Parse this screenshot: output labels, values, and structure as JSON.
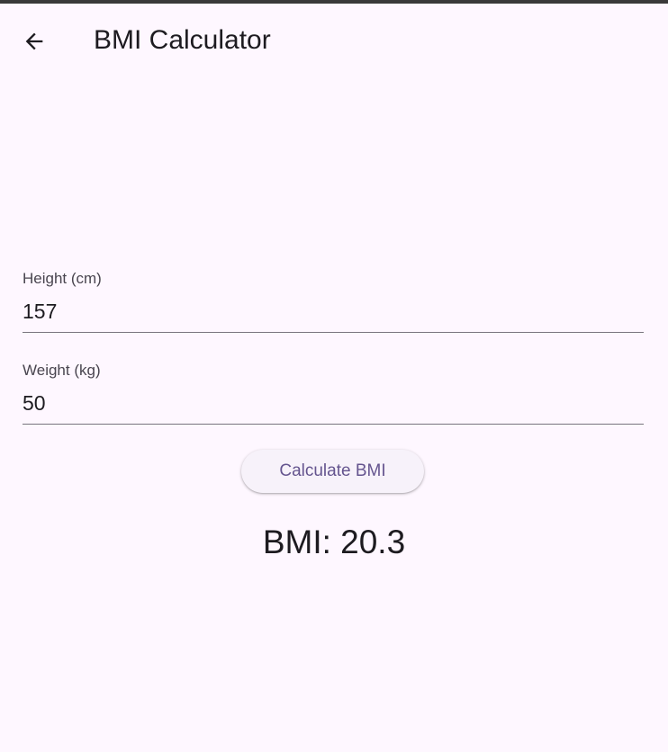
{
  "app_bar": {
    "title": "BMI Calculator",
    "back_icon": "arrow-back-icon"
  },
  "form": {
    "height": {
      "label": "Height (cm)",
      "value": "157"
    },
    "weight": {
      "label": "Weight (kg)",
      "value": "50"
    }
  },
  "actions": {
    "calculate_label": "Calculate BMI"
  },
  "result": {
    "text": "BMI: 20.3"
  },
  "colors": {
    "background": "#FEF7FF",
    "primary": "#65558F",
    "on_surface": "#1D1B20",
    "label": "#49454F",
    "outline": "#79747E"
  }
}
